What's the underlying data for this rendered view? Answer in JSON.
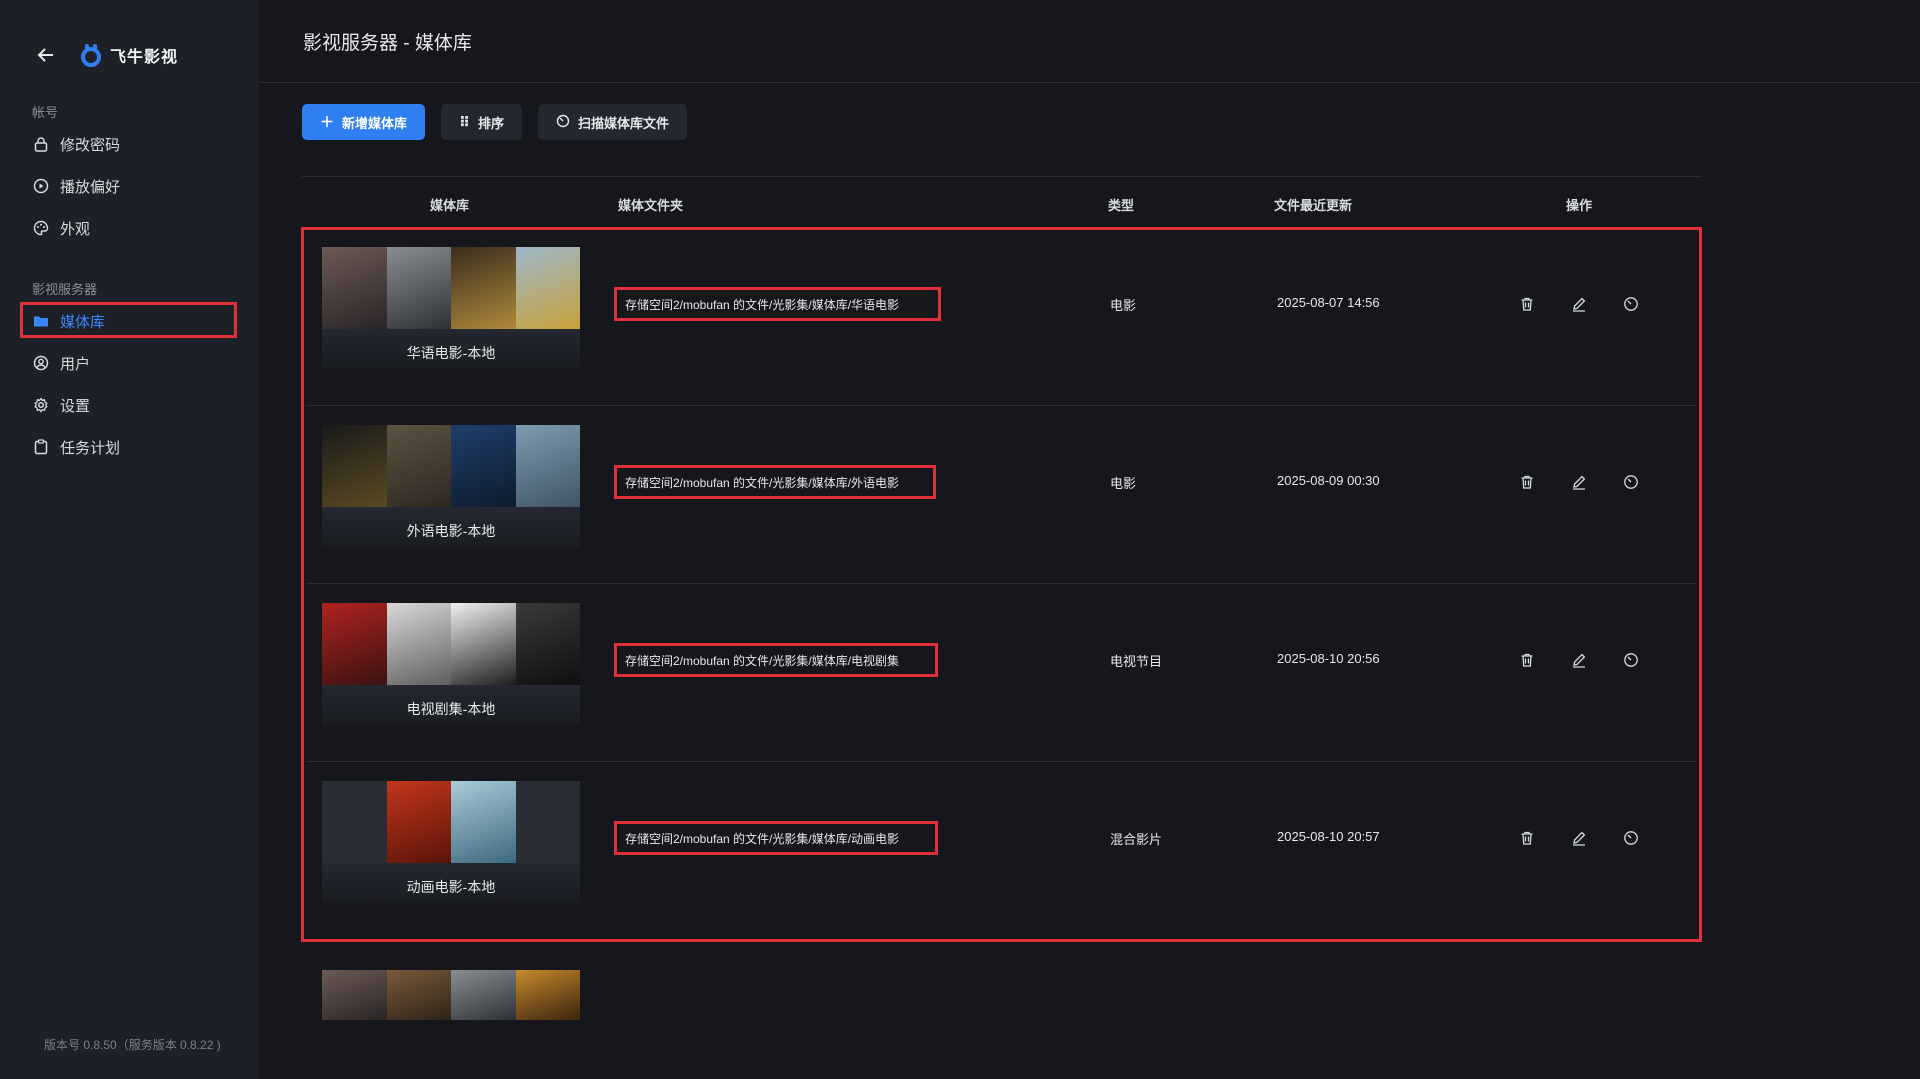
{
  "app": {
    "name": "飞牛影视"
  },
  "sidebar": {
    "account_section": "帐号",
    "account_items": [
      {
        "label": "修改密码",
        "icon": "lock-icon"
      },
      {
        "label": "播放偏好",
        "icon": "play-circle-icon"
      },
      {
        "label": "外观",
        "icon": "palette-icon"
      }
    ],
    "server_section": "影视服务器",
    "server_items": [
      {
        "label": "媒体库",
        "icon": "folder-icon",
        "active": true
      },
      {
        "label": "用户",
        "icon": "user-circle-icon"
      },
      {
        "label": "设置",
        "icon": "gear-icon"
      },
      {
        "label": "任务计划",
        "icon": "clipboard-icon"
      }
    ],
    "version": "版本号 0.8.50（服务版本 0.8.22 )"
  },
  "page": {
    "title": "影视服务器 - 媒体库"
  },
  "toolbar": {
    "add_label": "新增媒体库",
    "sort_label": "排序",
    "scan_label": "扫描媒体库文件"
  },
  "table": {
    "headers": {
      "library": "媒体库",
      "folder": "媒体文件夹",
      "type": "类型",
      "updated": "文件最近更新",
      "actions": "操作"
    },
    "rows": [
      {
        "name": "华语电影-本地",
        "folder": "存储空间2/mobufan 的文件/光影集/媒体库/华语电影",
        "type": "电影",
        "updated": "2025-08-07 14:56"
      },
      {
        "name": "外语电影-本地",
        "folder": "存储空间2/mobufan 的文件/光影集/媒体库/外语电影",
        "type": "电影",
        "updated": "2025-08-09 00:30"
      },
      {
        "name": "电视剧集-本地",
        "folder": "存储空间2/mobufan 的文件/光影集/媒体库/电视剧集",
        "type": "电视节目",
        "updated": "2025-08-10 20:56"
      },
      {
        "name": "动画电影-本地",
        "folder": "存储空间2/mobufan 的文件/光影集/媒体库/动画电影",
        "type": "混合影片",
        "updated": "2025-08-10 20:57"
      }
    ]
  },
  "colors": {
    "accent": "#2f7ff2",
    "active_nav": "#3a86ff",
    "highlight": "#e0313b",
    "sidebar_bg": "#1d2027",
    "page_bg": "#15171c"
  }
}
